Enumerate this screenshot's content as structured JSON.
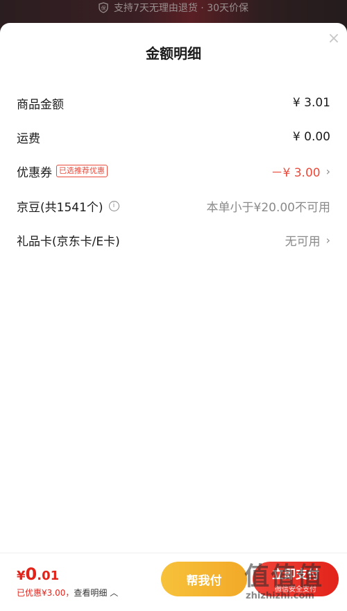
{
  "banner": {
    "text": "支持7天无理由退货 · 30天价保",
    "icon": "shield-icon"
  },
  "sheet": {
    "title": "金额明细",
    "close_icon": "×"
  },
  "rows": [
    {
      "label": "商品金额",
      "value": "¥ 3.01"
    },
    {
      "label": "运费",
      "value": "¥ 0.00"
    },
    {
      "label": "优惠券",
      "tag": "已选推荐优惠",
      "value": "－¥ 3.00"
    },
    {
      "label": "京豆(共1541个)",
      "value": "本单小于¥20.00不可用"
    },
    {
      "label": "礼品卡(京东卡/E卡)",
      "value": "无可用"
    }
  ],
  "bottom": {
    "price_yen": "¥",
    "price_int": "0",
    "price_dec": ".01",
    "saved": "已优惠¥3.00，",
    "detail_link": "查看明细",
    "help_pay": "帮我付",
    "pay_main": "立即支付",
    "pay_sub": "微信安全支付"
  },
  "watermark": {
    "big": "值值值",
    "small": "zhizhizhi.com"
  },
  "colors": {
    "accent_red": "#e2231a",
    "coupon_red": "#e94b3c",
    "help_button": "#f2a928"
  }
}
